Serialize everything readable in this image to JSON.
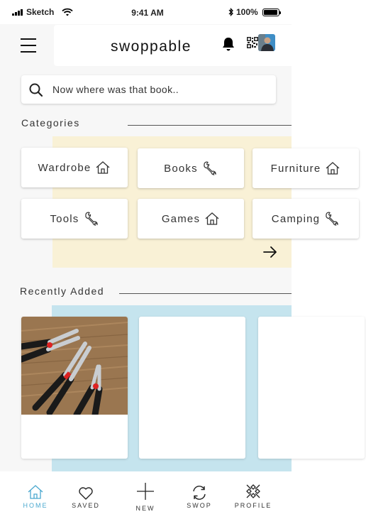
{
  "status_bar": {
    "carrier": "Sketch",
    "time": "9:41 AM",
    "battery": "100%"
  },
  "header": {
    "title": "swoppable",
    "icons": [
      "menu-icon",
      "bell-icon",
      "qr-code-icon",
      "avatar"
    ]
  },
  "search": {
    "placeholder": "Now where was that book.."
  },
  "categories": {
    "title": "Categories",
    "items": [
      {
        "label": "Wardrobe",
        "icon": "house-icon"
      },
      {
        "label": "Books",
        "icon": "wrench-icon"
      },
      {
        "label": "Furniture",
        "icon": "house-icon"
      },
      {
        "label": "Tools",
        "icon": "wrench-icon"
      },
      {
        "label": "Games",
        "icon": "house-icon"
      },
      {
        "label": "Camping",
        "icon": "wrench-icon"
      }
    ],
    "more_icon": "arrow-right-icon"
  },
  "recent": {
    "title": "Recently Added"
  },
  "bottom_nav": [
    {
      "label": "HOME",
      "icon": "house-icon",
      "active": true
    },
    {
      "label": "SAVED",
      "icon": "heart-icon",
      "active": false
    },
    {
      "label": "NEW",
      "icon": "plus-icon",
      "active": false
    },
    {
      "label": "SWOP",
      "icon": "swap-arrows-icon",
      "active": false
    },
    {
      "label": "PROFILE",
      "icon": "profile-pattern-icon",
      "active": false
    }
  ],
  "colors": {
    "accent": "#4aa8cf",
    "categories_bg": "#f9f1d6",
    "recent_bg": "#c5e4ee"
  }
}
